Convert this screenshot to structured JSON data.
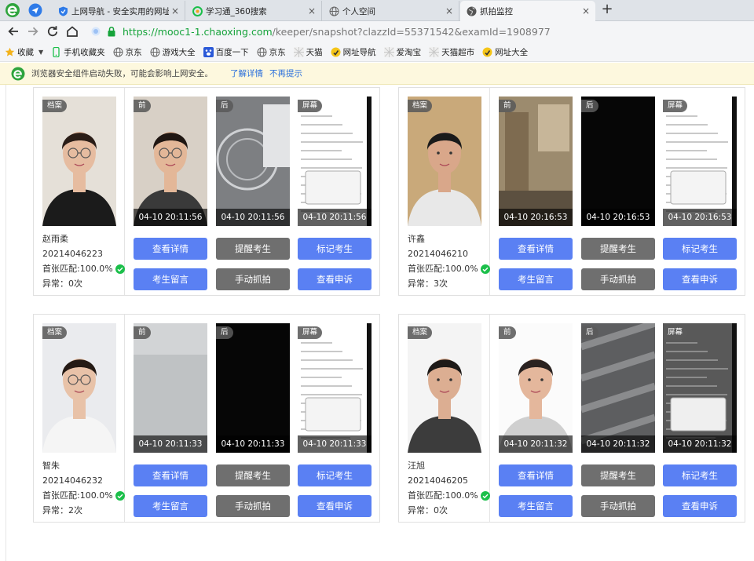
{
  "tabs": [
    {
      "title": "上网导航 - 安全实用的网址导",
      "icon": "shield-favicon"
    },
    {
      "title": "学习通_360搜索",
      "icon": "search-favicon"
    },
    {
      "title": "个人空间",
      "icon": "globe-favicon"
    },
    {
      "title": "抓拍监控",
      "icon": "globe-favicon",
      "active": true
    }
  ],
  "tab_close": "×",
  "newtab": "+",
  "address": {
    "url_host": "https://mooc1-1.chaoxing.com",
    "url_rest": "/keeper/snapshot?clazzId=55371542&examId=1908977"
  },
  "bookmarks": [
    {
      "label": "收藏",
      "icon": "star-icon"
    },
    {
      "label": "手机收藏夹",
      "icon": "phone-icon"
    },
    {
      "label": "京东",
      "icon": "globe-icon"
    },
    {
      "label": "游戏大全",
      "icon": "globe-icon"
    },
    {
      "label": "百度一下",
      "icon": "paw-icon"
    },
    {
      "label": "京东",
      "icon": "globe-icon"
    },
    {
      "label": "天猫",
      "icon": "cat-icon"
    },
    {
      "label": "网址导航",
      "icon": "nav-icon"
    },
    {
      "label": "爱淘宝",
      "icon": "cat-icon"
    },
    {
      "label": "天猫超市",
      "icon": "cat-icon"
    },
    {
      "label": "网址大全",
      "icon": "nav-icon"
    }
  ],
  "infobar": {
    "message": "浏览器安全组件启动失败，可能会影响上网安全。",
    "link1": "了解详情",
    "link2": "不再提示"
  },
  "labels": {
    "profile": "档案",
    "front": "前",
    "back": "后",
    "screen": "屏幕",
    "match_prefix": "首张匹配:",
    "abnormal_prefix": "异常：",
    "btn_details": "查看详情",
    "btn_remind": "提醒考生",
    "btn_mark": "标记考生",
    "btn_message": "考生留言",
    "btn_capture": "手动抓拍",
    "btn_appeal": "查看申诉"
  },
  "colors": {
    "primary_button": "#5a80f3",
    "secondary_button": "#6f6f6f",
    "url_green": "#15a33a",
    "check_green": "#1bbf4a"
  },
  "students": [
    {
      "name": "赵雨柔",
      "id": "20214046223",
      "match": "100.0%",
      "abnormal": "0次",
      "times": [
        "04-10 20:11:56",
        "04-10 20:11:56",
        "04-10 20:11:56"
      ]
    },
    {
      "name": "许鑫",
      "id": "20214046210",
      "match": "100.0%",
      "abnormal": "3次",
      "times": [
        "04-10 20:16:53",
        "04-10 20:16:53",
        "04-10 20:16:53"
      ]
    },
    {
      "name": "智朱",
      "id": "20214046232",
      "match": "100.0%",
      "abnormal": "2次",
      "times": [
        "04-10 20:11:33",
        "04-10 20:11:33",
        "04-10 20:11:33"
      ]
    },
    {
      "name": "汪旭",
      "id": "20214046205",
      "match": "100.0%",
      "abnormal": "0次",
      "times": [
        "04-10 20:11:32",
        "04-10 20:11:32",
        "04-10 20:11:32"
      ]
    }
  ]
}
